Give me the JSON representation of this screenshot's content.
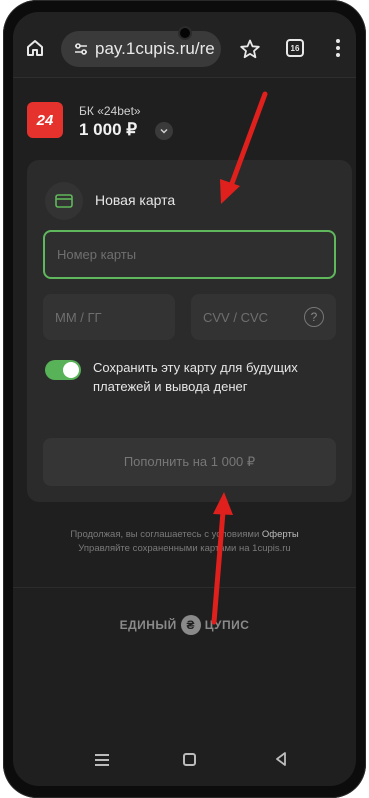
{
  "browser": {
    "url": "pay.1cupis.ru/re",
    "tabs_count": "16"
  },
  "merchant": {
    "logo_text": "24",
    "name": "БК «24bet»",
    "amount": "1 000 ₽"
  },
  "form": {
    "title": "Новая карта",
    "card_number_placeholder": "Номер карты",
    "expiry_placeholder": "ММ / ГГ",
    "cvv_placeholder": "CVV / CVC",
    "cvv_help": "?",
    "save_card_label": "Сохранить эту карту для будущих платежей и вывода денег",
    "save_card_enabled": true,
    "pay_button": "Пополнить на 1 000 ₽"
  },
  "footer": {
    "terms_line1_prefix": "Продолжая, вы соглашаетесь с условиями ",
    "terms_link": "Оферты",
    "terms_line2": "Управляйте сохраненными картами на 1cupis.ru",
    "brand_left": "ЕДИНЫЙ",
    "brand_right": "ЦУПИС"
  },
  "colors": {
    "accent_green": "#58b257",
    "logo_red": "#e5322d",
    "annotation_red": "#e0201c"
  }
}
